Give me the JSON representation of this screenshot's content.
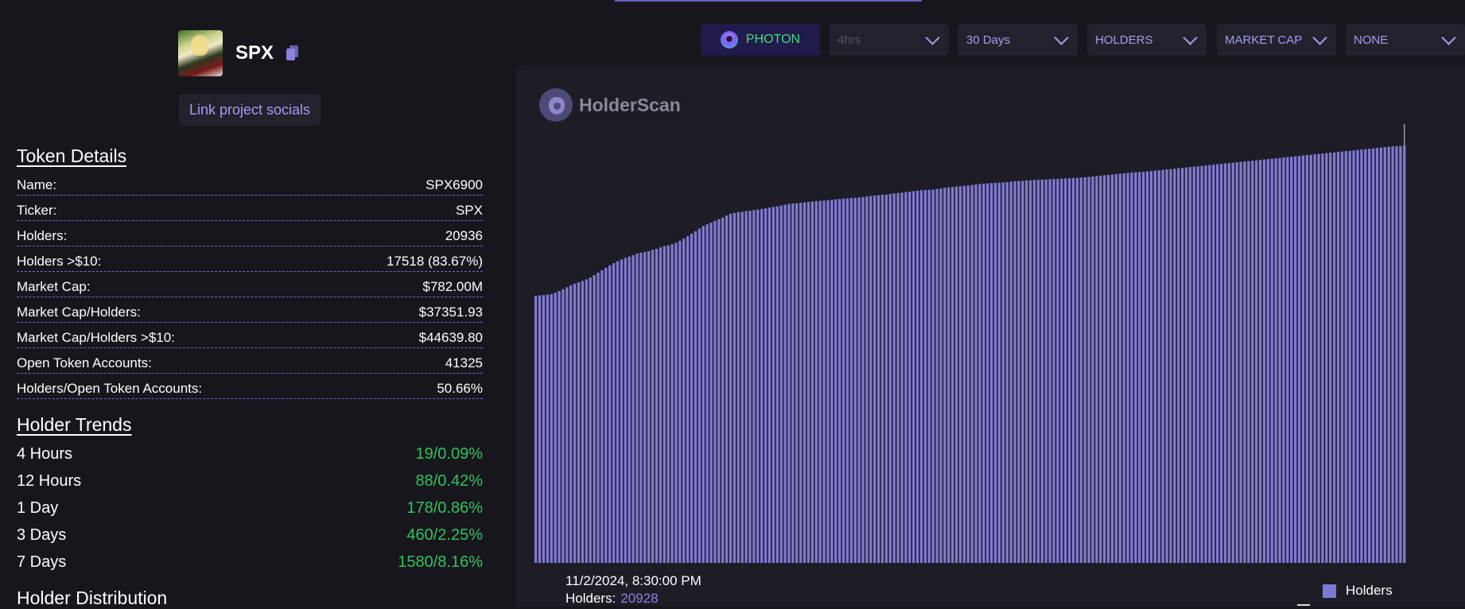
{
  "token": {
    "symbol": "SPX",
    "link_socials": "Link project socials"
  },
  "details": {
    "title": "Token Details",
    "rows": [
      {
        "label": "Name:",
        "value": "SPX6900"
      },
      {
        "label": "Ticker:",
        "value": "SPX"
      },
      {
        "label": "Holders:",
        "value": "20936"
      },
      {
        "label": "Holders >$10:",
        "value": "17518 (83.67%)"
      },
      {
        "label": "Market Cap:",
        "value": "$782.00M"
      },
      {
        "label": "Market Cap/Holders:",
        "value": "$37351.93"
      },
      {
        "label": "Market Cap/Holders >$10:",
        "value": "$44639.80"
      },
      {
        "label": "Open Token Accounts:",
        "value": "41325"
      },
      {
        "label": "Holders/Open Token Accounts:",
        "value": "50.66%"
      }
    ]
  },
  "trends": {
    "title": "Holder Trends",
    "rows": [
      {
        "label": "4 Hours",
        "value": "19/0.09%"
      },
      {
        "label": "12 Hours",
        "value": "88/0.42%"
      },
      {
        "label": "1 Day",
        "value": "178/0.86%"
      },
      {
        "label": "3 Days",
        "value": "460/2.25%"
      },
      {
        "label": "7 Days",
        "value": "1580/8.16%"
      }
    ]
  },
  "distribution": {
    "title": "Holder Distribution"
  },
  "controls": {
    "photon_label": "PHOTON",
    "interval": "4hrs",
    "range": "30 Days",
    "metric": "HOLDERS",
    "overlay": "MARKET CAP",
    "compare": "NONE"
  },
  "brand": {
    "name": "HolderScan"
  },
  "tooltip": {
    "date": "11/2/2024, 8:30:00 PM",
    "label": "Holders:",
    "value": "20928"
  },
  "colors": {
    "bar": "#8079d4",
    "accent": "#a29cf0",
    "positive": "#2ec45c"
  },
  "chart_data": {
    "type": "bar",
    "title": "",
    "legend": [
      "Holders"
    ],
    "legend_position": "bottom-right",
    "grid": false,
    "ylim": [
      0,
      22100
    ],
    "series": [
      {
        "name": "Holders",
        "values": [
          13400,
          13420,
          13440,
          13460,
          13480,
          13560,
          13640,
          13730,
          13830,
          13930,
          14010,
          14080,
          14150,
          14220,
          14320,
          14440,
          14560,
          14680,
          14800,
          14930,
          15040,
          15130,
          15220,
          15300,
          15370,
          15440,
          15520,
          15560,
          15600,
          15640,
          15710,
          15760,
          15830,
          15900,
          15930,
          15990,
          16060,
          16160,
          16270,
          16390,
          16520,
          16640,
          16770,
          16900,
          16990,
          17070,
          17160,
          17240,
          17330,
          17430,
          17520,
          17560,
          17600,
          17620,
          17650,
          17670,
          17700,
          17730,
          17760,
          17790,
          17820,
          17860,
          17890,
          17930,
          17970,
          18010,
          18030,
          18050,
          18070,
          18090,
          18110,
          18130,
          18150,
          18170,
          18180,
          18200,
          18220,
          18240,
          18260,
          18280,
          18290,
          18310,
          18320,
          18340,
          18360,
          18380,
          18410,
          18430,
          18450,
          18470,
          18480,
          18510,
          18540,
          18560,
          18580,
          18600,
          18630,
          18650,
          18680,
          18700,
          18710,
          18720,
          18730,
          18760,
          18790,
          18820,
          18840,
          18860,
          18880,
          18900,
          18920,
          18940,
          18960,
          18990,
          19010,
          19030,
          19040,
          19060,
          19070,
          19080,
          19090,
          19110,
          19130,
          19150,
          19160,
          19170,
          19190,
          19200,
          19210,
          19220,
          19230,
          19240,
          19250,
          19260,
          19270,
          19280,
          19290,
          19300,
          19310,
          19320,
          19330,
          19350,
          19370,
          19390,
          19410,
          19430,
          19450,
          19470,
          19490,
          19510,
          19530,
          19550,
          19570,
          19590,
          19600,
          19610,
          19620,
          19640,
          19660,
          19680,
          19700,
          19720,
          19740,
          19760,
          19780,
          19800,
          19820,
          19840,
          19860,
          19880,
          19900,
          19920,
          19940,
          19960,
          19980,
          20000,
          20020,
          20040,
          20060,
          20080,
          20100,
          20120,
          20140,
          20160,
          20180,
          20200,
          20220,
          20240,
          20260,
          20280,
          20300,
          20320,
          20340,
          20360,
          20380,
          20400,
          20420,
          20440,
          20460,
          20480,
          20500,
          20520,
          20540,
          20560,
          20580,
          20600,
          20620,
          20640,
          20660,
          20680,
          20700,
          20720,
          20740,
          20760,
          20780,
          20800,
          20820,
          20840,
          20860,
          20880,
          20900,
          20910,
          20920,
          20928
        ]
      }
    ]
  }
}
